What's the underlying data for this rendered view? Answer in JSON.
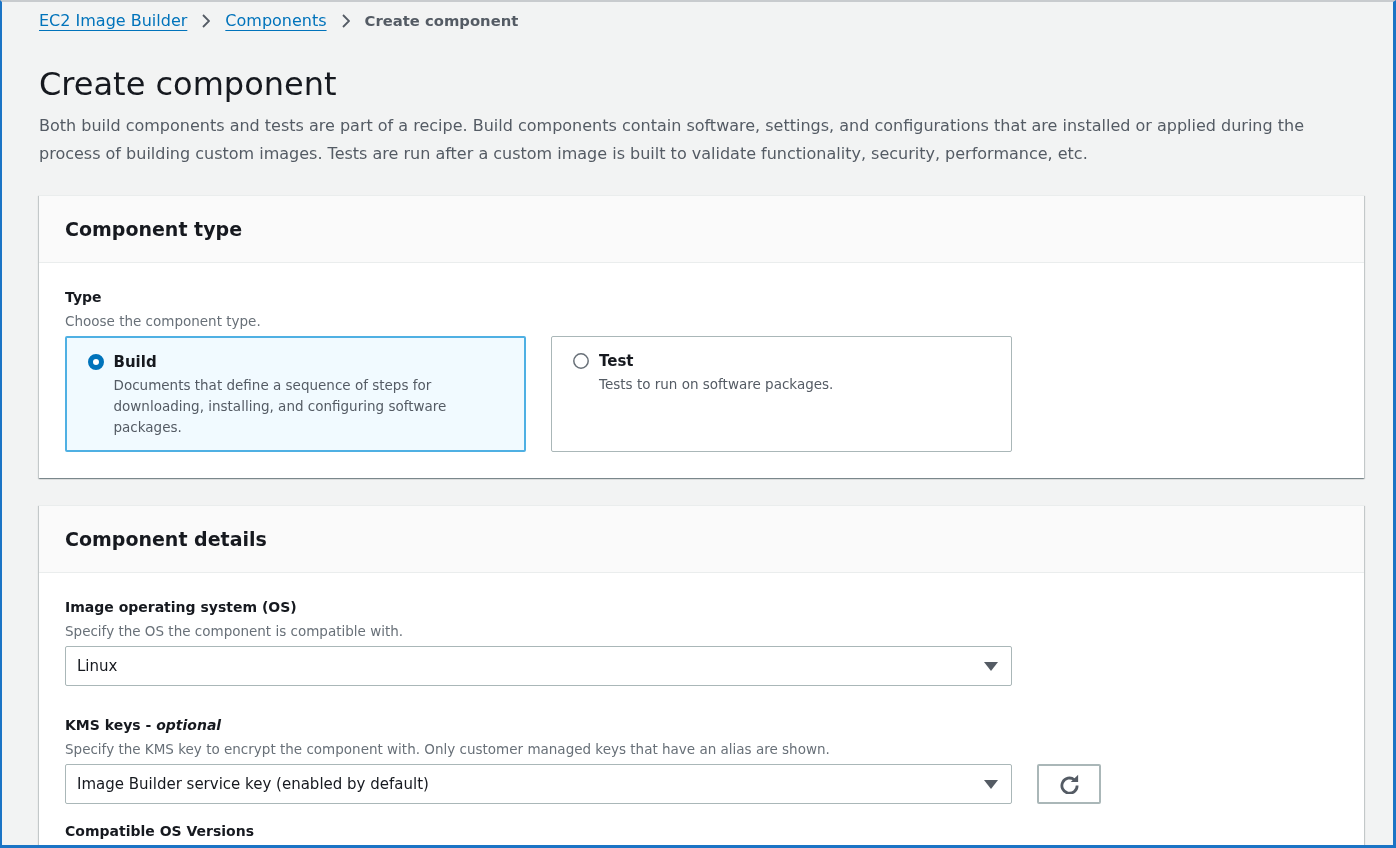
{
  "breadcrumbs": [
    {
      "label": "EC2 Image Builder",
      "kind": "link"
    },
    {
      "label": "Components",
      "kind": "link"
    },
    {
      "label": "Create component",
      "kind": "current"
    }
  ],
  "page": {
    "title": "Create component",
    "description": "Both build components and tests are part of a recipe. Build components contain software, settings, and configurations that are installed or applied during the process of building custom images. Tests are run after a custom image is built to validate functionality, security, performance, etc."
  },
  "component_type": {
    "title": "Component type",
    "field": {
      "label": "Type",
      "hint": "Choose the component type.",
      "options": [
        {
          "label": "Build",
          "description": "Documents that define a sequence of steps for downloading, installing, and configuring software packages.",
          "selected": true
        },
        {
          "label": "Test",
          "description": "Tests to run on software packages.",
          "selected": false
        }
      ]
    }
  },
  "component_details": {
    "title": "Component details",
    "fields": [
      {
        "kind": "select",
        "label": "Image operating system (OS)",
        "hint": "Specify the OS the component is compatible with.",
        "value": "Linux",
        "refresh": false
      },
      {
        "kind": "select",
        "label": "KMS keys - *optional*",
        "hint": "Specify the KMS key to encrypt the component with. Only customer managed keys that have an alias are shown.",
        "value": "Image Builder service key (enabled by default)",
        "refresh": true
      },
      {
        "kind": "label",
        "label": "Compatible OS Versions"
      }
    ]
  }
}
